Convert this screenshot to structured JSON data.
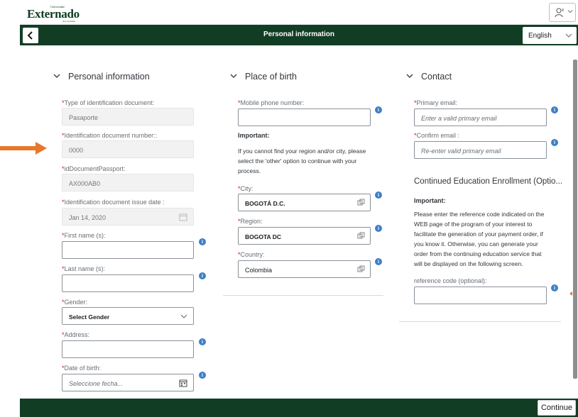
{
  "brand": {
    "logo_small": "Universidad",
    "logo_main": "Externado",
    "logo_sub": "de Colombia"
  },
  "header": {
    "title": "Personal information",
    "language": "English",
    "back_icon": "chevron-left-icon",
    "user_icon": "person-icon"
  },
  "personal": {
    "title": "Personal information",
    "fields": {
      "id_type": {
        "label": "Type of identification document:",
        "value": "Pasaporte"
      },
      "id_number": {
        "label": "Identification document number::",
        "value": "0000"
      },
      "passport": {
        "label": "idDocumentPassport:",
        "value": "AX000AB0"
      },
      "issue_date": {
        "label": "Identification document issue date :",
        "value": "Jan 14, 2020"
      },
      "first_name": {
        "label": "First name (s):",
        "value": ""
      },
      "last_name": {
        "label": "Last name (s):",
        "value": ""
      },
      "gender": {
        "label": "Gender:",
        "value": "Select Gender"
      },
      "address": {
        "label": "Address:",
        "value": ""
      },
      "dob": {
        "label": "Date of birth:",
        "placeholder": "Seleccione fecha..."
      }
    }
  },
  "birth": {
    "title": "Place of birth",
    "mobile": {
      "label": "Mobile phone number:",
      "value": ""
    },
    "important_title": "Important:",
    "important_text": "If you cannot find your region and/or city, please select the 'other' option to continue with your process.",
    "city": {
      "label": "City:",
      "value": "BOGOTÁ D.C."
    },
    "region": {
      "label": "Region:",
      "value": "BOGOTA DC"
    },
    "country": {
      "label": "Country:",
      "value": "Colombia"
    }
  },
  "contact": {
    "title": "Contact",
    "primary_email": {
      "label": "Primary email:",
      "placeholder": "Enter a valid primary email"
    },
    "confirm_email": {
      "label": "Confirm email :",
      "placeholder": "Re-enter valid primary email"
    },
    "ce_title": "Continued Education Enrollment (Optio...",
    "important_title": "Important:",
    "important_text": "Please enter the reference code indicated on the WEB page of the program of your interest to facilitate the generation of your payment order, if you know it. Otherwise, you can generate your order from the continuing education service that will be displayed on the following screen.",
    "ref_code": {
      "label": "reference code (optional):",
      "value": ""
    }
  },
  "required_mark": "*",
  "footer": {
    "continue_label": "Continue"
  },
  "colors": {
    "nav_green": "#123d25",
    "info_blue": "#3d7fc9",
    "required_red": "#c8102e",
    "annotation_orange": "#e8772e"
  }
}
